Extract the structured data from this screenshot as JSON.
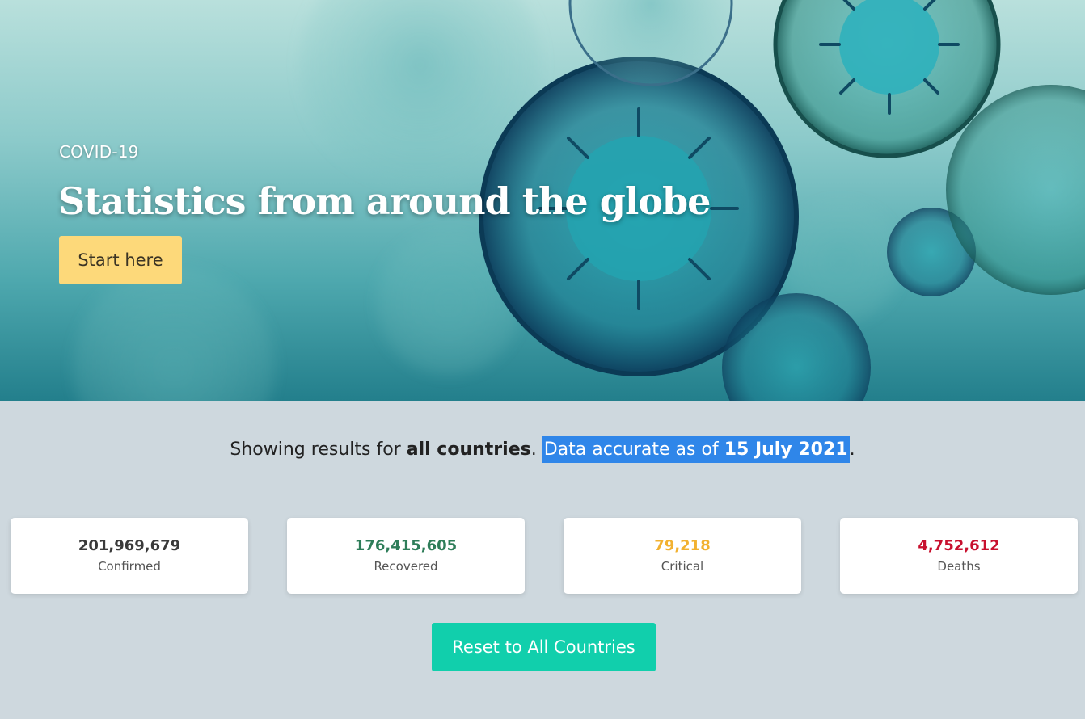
{
  "hero": {
    "eyebrow": "COVID-19",
    "title": "Statistics from around the globe",
    "start_label": "Start here"
  },
  "summary": {
    "prefix": "Showing results for ",
    "scope": "all countries",
    "separator": ".",
    "accuracy_prefix": "Data accurate as of ",
    "date": "15 July 2021",
    "suffix": "."
  },
  "stats": [
    {
      "value": "201,969,679",
      "label": "Confirmed",
      "color": "#3a3a3a"
    },
    {
      "value": "176,415,605",
      "label": "Recovered",
      "color": "#2e7d59"
    },
    {
      "value": "79,218",
      "label": "Critical",
      "color": "#f2b130"
    },
    {
      "value": "4,752,612",
      "label": "Deaths",
      "color": "#c8102e"
    }
  ],
  "reset_label": "Reset to All Countries",
  "colors": {
    "accent_button": "#11cfac",
    "start_button": "#fdd97a",
    "highlight": "#2f86e9",
    "page_bg": "#ced8de"
  }
}
